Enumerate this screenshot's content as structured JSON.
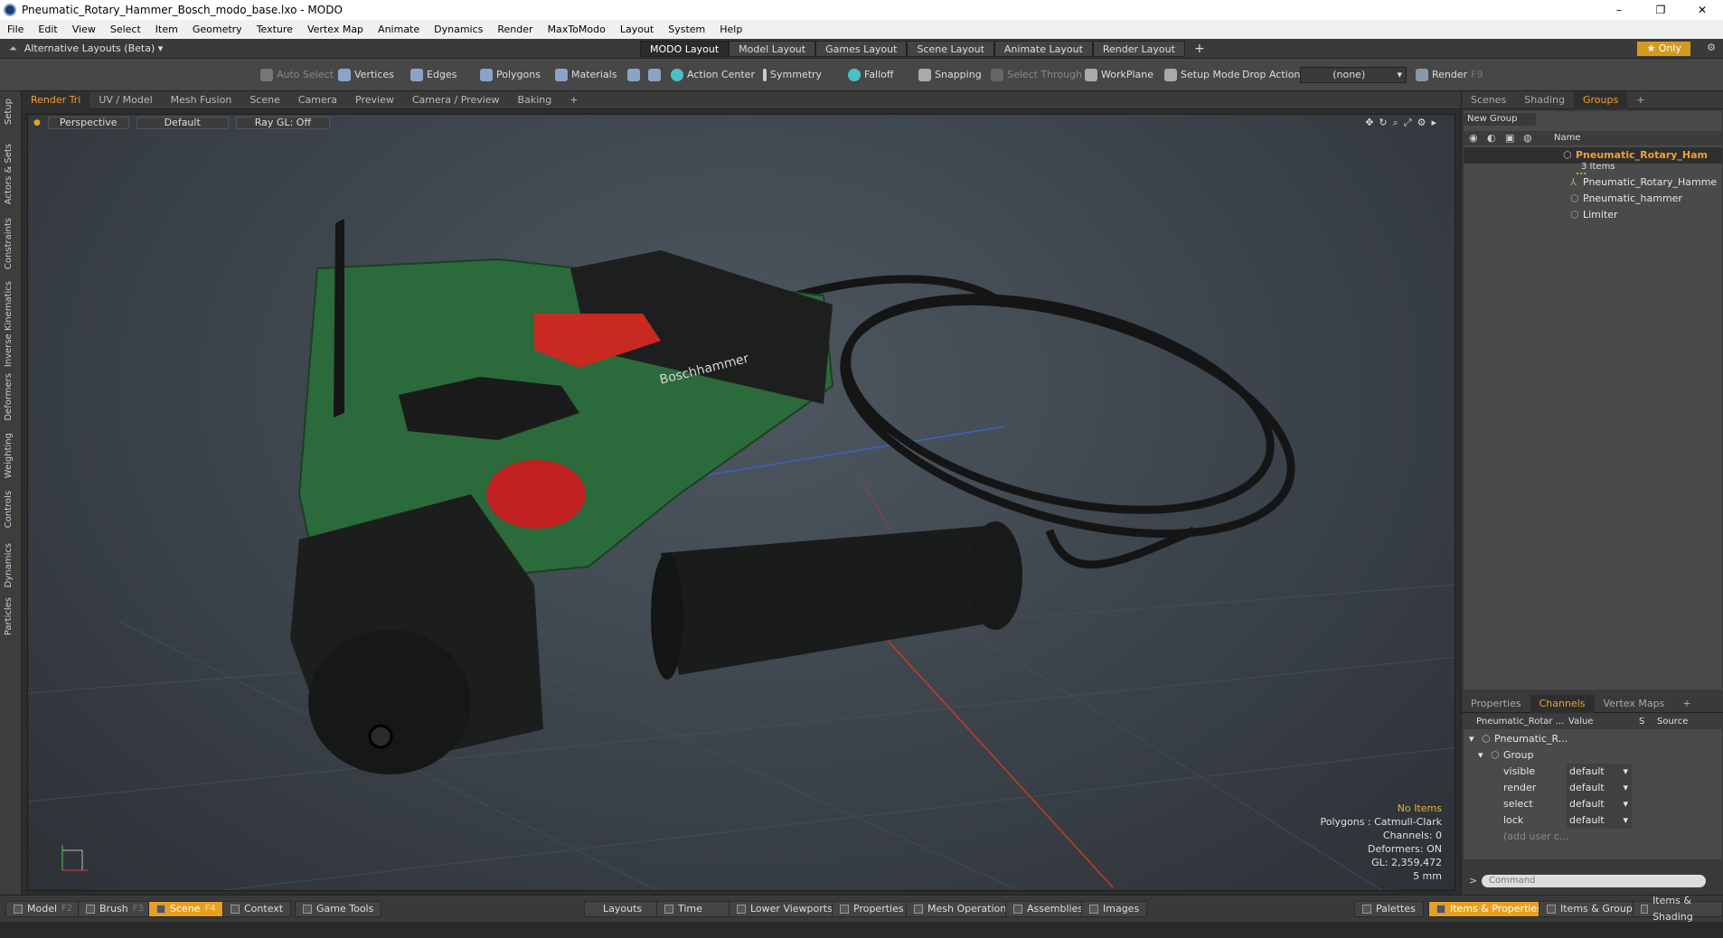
{
  "window": {
    "title": "Pneumatic_Rotary_Hammer_Bosch_modo_base.lxo - MODO",
    "minimize": "–",
    "restore": "❐",
    "close": "✕"
  },
  "menu": [
    "File",
    "Edit",
    "View",
    "Select",
    "Item",
    "Geometry",
    "Texture",
    "Vertex Map",
    "Animate",
    "Dynamics",
    "Render",
    "MaxToModo",
    "Layout",
    "System",
    "Help"
  ],
  "layoutbar": {
    "alt_layouts": "Alternative Layouts (Beta) ▾",
    "tabs": [
      "MODO Layout",
      "Model Layout",
      "Games Layout",
      "Scene Layout",
      "Animate Layout",
      "Render Layout"
    ],
    "add": "+",
    "only": "★ Only"
  },
  "toolbar": {
    "auto_select": "Auto Select",
    "vertices": "Vertices",
    "edges": "Edges",
    "polygons": "Polygons",
    "materials": "Materials",
    "action_center": "Action Center",
    "symmetry": "Symmetry",
    "falloff": "Falloff",
    "snapping": "Snapping",
    "select_through": "Select Through",
    "workplane": "WorkPlane",
    "setup_mode": "Setup Mode",
    "drop_action": "Drop Action",
    "none": "(none)",
    "render": "Render",
    "render_key": "F9"
  },
  "left_tabs": [
    "Setup",
    "Actors & Sets",
    "Constraints",
    "Inverse Kinematics",
    "Deformers",
    "Weighting",
    "Controls",
    "Dynamics",
    "Particles"
  ],
  "viewport_tabs": [
    "Render Tri",
    "UV / Model",
    "Mesh Fusion",
    "Scene",
    "Camera",
    "Preview",
    "Camera / Preview",
    "Baking",
    "+"
  ],
  "viewport": {
    "perspective": "Perspective",
    "default": "Default",
    "raygl": "Ray GL: Off",
    "info": {
      "no_items": "No Items",
      "polygons": "Polygons : Catmull-Clark",
      "channels": "Channels: 0",
      "deformers": "Deformers: ON",
      "gl": "GL: 2,359,472",
      "unit": "5 mm"
    },
    "brand_text": "Boschhammer"
  },
  "right_tabs_top": [
    "Scenes",
    "Shading",
    "Groups",
    "+"
  ],
  "groups": {
    "new_group": "New Group",
    "name_col": "Name",
    "root": "Pneumatic_Rotary_Ham ...",
    "root_count": "3 Items",
    "children": [
      "Pneumatic_Rotary_Hamme ...",
      "Pneumatic_hammer",
      "Limiter"
    ]
  },
  "right_tabs_bottom": [
    "Properties",
    "Channels",
    "Vertex Maps",
    "+"
  ],
  "channels": {
    "col_name": "Pneumatic_Rotar ...",
    "col_value": "Value",
    "col_s": "S",
    "col_source": "Source",
    "item": "Pneumatic_R...",
    "group": "Group",
    "rows": [
      {
        "label": "visible",
        "value": "default"
      },
      {
        "label": "render",
        "value": "default"
      },
      {
        "label": "select",
        "value": "default"
      },
      {
        "label": "lock",
        "value": "default"
      }
    ],
    "add_user": "(add user c..."
  },
  "command": {
    "placeholder": "Command",
    "prompt": ">"
  },
  "bottombar": {
    "model": "Model",
    "model_key": "F2",
    "brush": "Brush",
    "brush_key": "F3",
    "scene": "Scene",
    "scene_key": "F4",
    "context": "Context",
    "game_tools": "Game Tools",
    "layouts": "Layouts",
    "time": "Time",
    "lower_viewports": "Lower Viewports",
    "properties": "Properties",
    "mesh_operations": "Mesh Operations",
    "assemblies": "Assemblies",
    "images": "Images",
    "palettes": "Palettes",
    "items_properties": "Items & Properties",
    "items_groups": "Items & Groups",
    "items_shading": "Items & Shading"
  }
}
